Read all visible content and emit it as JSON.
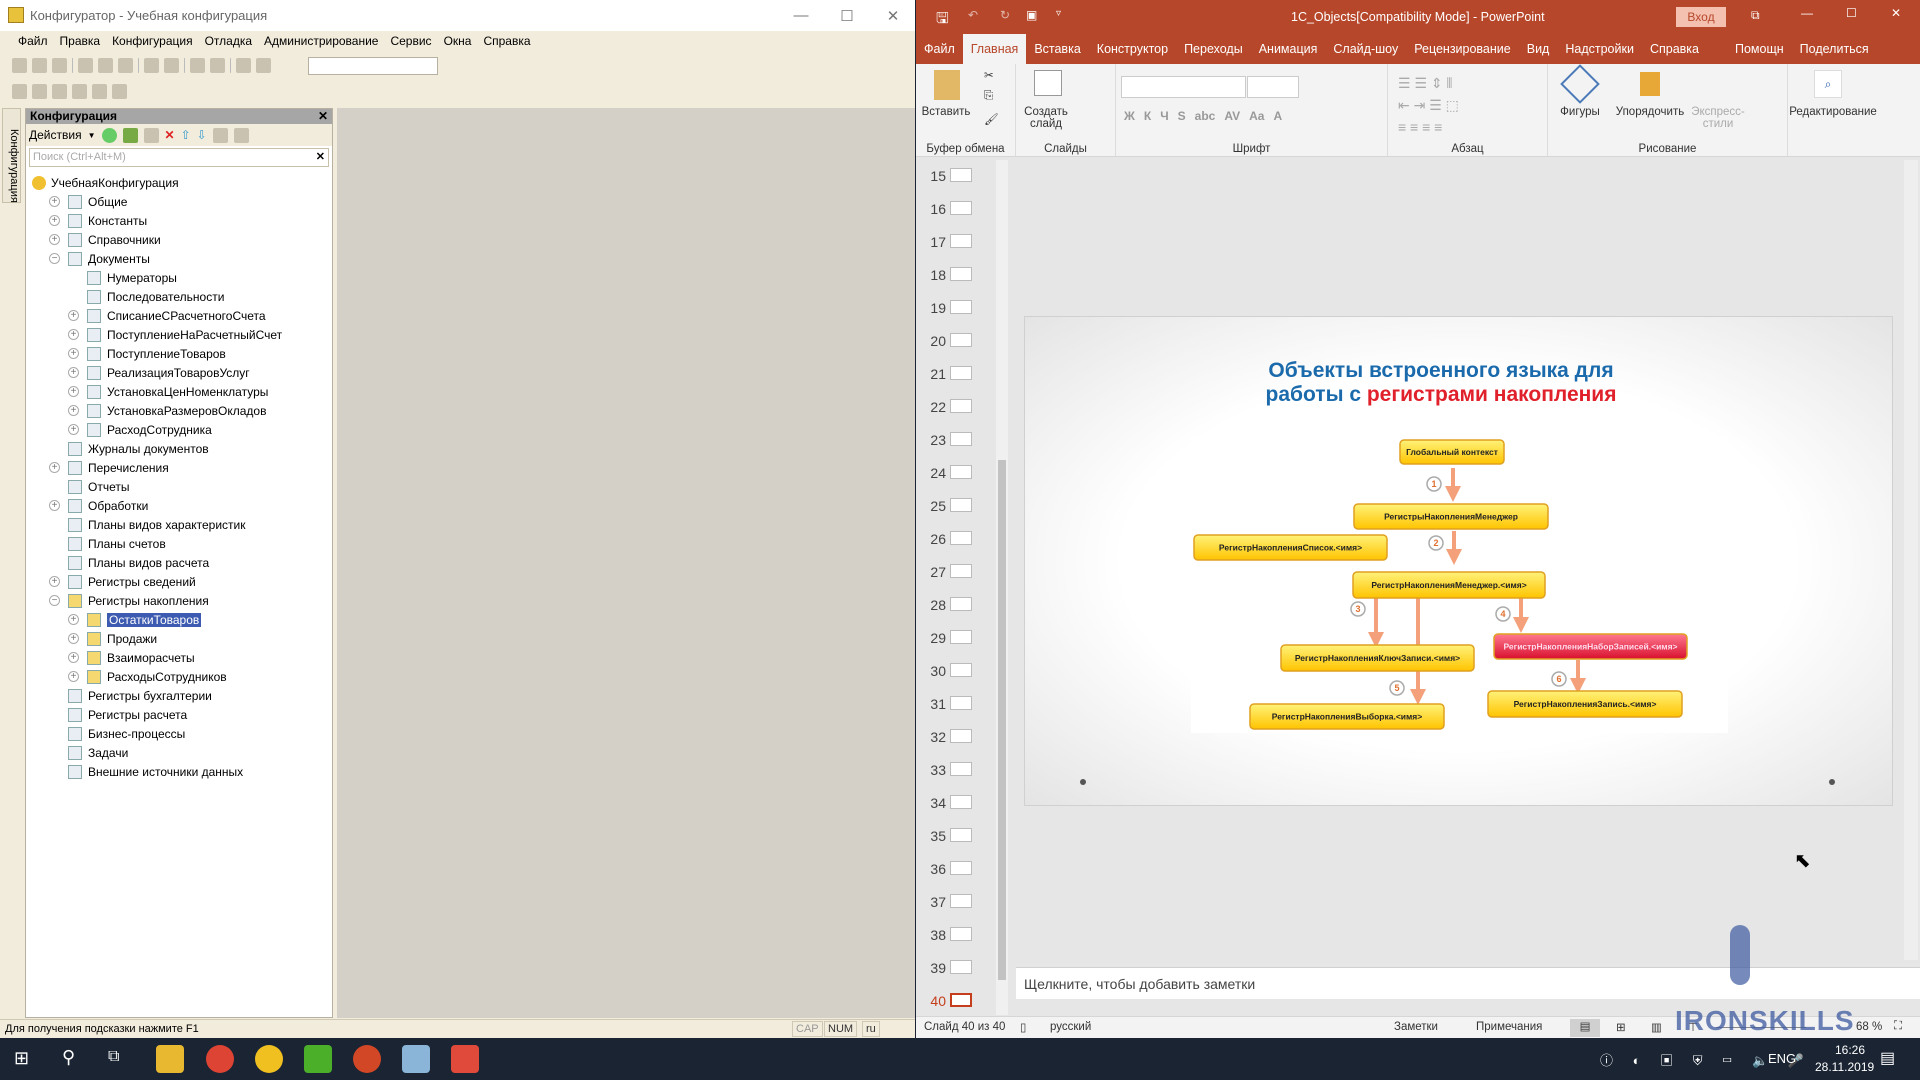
{
  "c1": {
    "title": "Конфигуратор - Учебная конфигурация",
    "menu": [
      "Файл",
      "Правка",
      "Конфигурация",
      "Отладка",
      "Администрирование",
      "Сервис",
      "Окна",
      "Справка"
    ],
    "panel_title": "Конфигурация",
    "actions": "Действия",
    "search_placeholder": "Поиск (Ctrl+Alt+M)",
    "side_tab": "Конфигурация",
    "tree": [
      {
        "label": "УчебнаяКонфигурация",
        "level": 0,
        "exp": "",
        "icon": "root-icon"
      },
      {
        "label": "Общие",
        "level": 1,
        "exp": "+",
        "icon": "common-icon"
      },
      {
        "label": "Константы",
        "level": 1,
        "exp": "+",
        "icon": "constants-icon"
      },
      {
        "label": "Справочники",
        "level": 1,
        "exp": "+",
        "icon": "catalogs-icon"
      },
      {
        "label": "Документы",
        "level": 1,
        "exp": "−",
        "icon": "documents-icon"
      },
      {
        "label": "Нумераторы",
        "level": 2,
        "exp": "",
        "icon": "numerators-icon"
      },
      {
        "label": "Последовательности",
        "level": 2,
        "exp": "",
        "icon": "sequences-icon"
      },
      {
        "label": "СписаниеСРасчетногоСчета",
        "level": 2,
        "exp": "+",
        "icon": "document-icon"
      },
      {
        "label": "ПоступлениеНаРасчетныйСчет",
        "level": 2,
        "exp": "+",
        "icon": "document-icon"
      },
      {
        "label": "ПоступлениеТоваров",
        "level": 2,
        "exp": "+",
        "icon": "document-icon"
      },
      {
        "label": "РеализацияТоваровУслуг",
        "level": 2,
        "exp": "+",
        "icon": "document-icon"
      },
      {
        "label": "УстановкаЦенНоменклатуры",
        "level": 2,
        "exp": "+",
        "icon": "document-icon"
      },
      {
        "label": "УстановкаРазмеровОкладов",
        "level": 2,
        "exp": "+",
        "icon": "document-icon"
      },
      {
        "label": "РасходСотрудника",
        "level": 2,
        "exp": "+",
        "icon": "document-icon"
      },
      {
        "label": "Журналы документов",
        "level": 1,
        "exp": "",
        "icon": "journals-icon"
      },
      {
        "label": "Перечисления",
        "level": 1,
        "exp": "+",
        "icon": "enums-icon"
      },
      {
        "label": "Отчеты",
        "level": 1,
        "exp": "",
        "icon": "reports-icon"
      },
      {
        "label": "Обработки",
        "level": 1,
        "exp": "+",
        "icon": "dataprocessors-icon"
      },
      {
        "label": "Планы видов характеристик",
        "level": 1,
        "exp": "",
        "icon": "chart-of-characteristics-icon"
      },
      {
        "label": "Планы счетов",
        "level": 1,
        "exp": "",
        "icon": "chart-of-accounts-icon"
      },
      {
        "label": "Планы видов расчета",
        "level": 1,
        "exp": "",
        "icon": "chart-of-calculation-icon"
      },
      {
        "label": "Регистры сведений",
        "level": 1,
        "exp": "+",
        "icon": "info-registers-icon"
      },
      {
        "label": "Регистры накопления",
        "level": 1,
        "exp": "−",
        "icon": "accumulation-registers-icon"
      },
      {
        "label": "ОстаткиТоваров",
        "level": 2,
        "exp": "+",
        "icon": "accumulation-register-icon",
        "selected": true
      },
      {
        "label": "Продажи",
        "level": 2,
        "exp": "+",
        "icon": "accumulation-register-icon"
      },
      {
        "label": "Взаиморасчеты",
        "level": 2,
        "exp": "+",
        "icon": "accumulation-register-icon"
      },
      {
        "label": "РасходыСотрудников",
        "level": 2,
        "exp": "+",
        "icon": "accumulation-register-icon"
      },
      {
        "label": "Регистры бухгалтерии",
        "level": 1,
        "exp": "",
        "icon": "accounting-registers-icon"
      },
      {
        "label": "Регистры расчета",
        "level": 1,
        "exp": "",
        "icon": "calculation-registers-icon"
      },
      {
        "label": "Бизнес-процессы",
        "level": 1,
        "exp": "",
        "icon": "business-processes-icon"
      },
      {
        "label": "Задачи",
        "level": 1,
        "exp": "",
        "icon": "tasks-icon"
      },
      {
        "label": "Внешние источники данных",
        "level": 1,
        "exp": "",
        "icon": "external-sources-icon"
      }
    ],
    "status": "Для получения подсказки нажмите F1",
    "cap": "CAP",
    "num": "NUM",
    "lang": "ru"
  },
  "ppt": {
    "title": "1C_Objects[Compatibility Mode]  -  PowerPoint",
    "login": "Вход",
    "tabs": [
      "Файл",
      "Главная",
      "Вставка",
      "Конструктор",
      "Переходы",
      "Анимация",
      "Слайд-шоу",
      "Рецензирование",
      "Вид",
      "Надстройки",
      "Справка",
      "Помощн",
      "Поделиться"
    ],
    "ribbon": {
      "paste": "Вставить",
      "new_slide": "Создать слайд",
      "shapes": "Фигуры",
      "arrange": "Упорядочить",
      "quick_styles": "Экспресс-стили",
      "editing": "Редактирование",
      "groups": [
        "Буфер обмена",
        "Слайды",
        "Шрифт",
        "Абзац",
        "Рисование"
      ],
      "font_buttons": [
        "Ж",
        "К",
        "Ч",
        "S",
        "abc",
        "AV",
        "Aa",
        "A"
      ]
    },
    "slides": [
      15,
      16,
      17,
      18,
      19,
      20,
      21,
      22,
      23,
      24,
      25,
      26,
      27,
      28,
      29,
      30,
      31,
      32,
      33,
      34,
      35,
      36,
      37,
      38,
      39,
      40
    ],
    "current_slide": 40,
    "slide": {
      "title_blue_1": "Объекты встроенного языка для",
      "title_blue_2": "работы с ",
      "title_red": "регистрами накопления",
      "boxes": {
        "global": "Глобальный контекст",
        "managers": "РегистрыНакопленияМенеджер",
        "list": "РегистрНакопленияСписок.<имя>",
        "manager": "РегистрНакопленияМенеджер.<имя>",
        "recordkey": "РегистрНакопленияКлючЗаписи.<имя>",
        "recordset": "РегистрНакопленияНаборЗаписей.<имя>",
        "selection": "РегистрНакопленияВыборка.<имя>",
        "record": "РегистрНакопленияЗапись.<имя>"
      },
      "steps": [
        "1",
        "2",
        "3",
        "4",
        "5",
        "6"
      ],
      "colors": {
        "blue": "#1a6aac",
        "red": "#e0202a",
        "box": "#ffd800",
        "box_red": "#e8284a",
        "arrow": "#f4a07a"
      }
    },
    "notes_placeholder": "Щелкните, чтобы добавить заметки",
    "status": {
      "slide": "Слайд 40 из 40",
      "language": "русский",
      "notes": "Заметки",
      "comments": "Примечания",
      "zoom": "68 %"
    }
  },
  "watermark": "IRONSKILLS",
  "taskbar": {
    "lang": "ENG",
    "time": "16:26",
    "date": "28.11.2019"
  }
}
